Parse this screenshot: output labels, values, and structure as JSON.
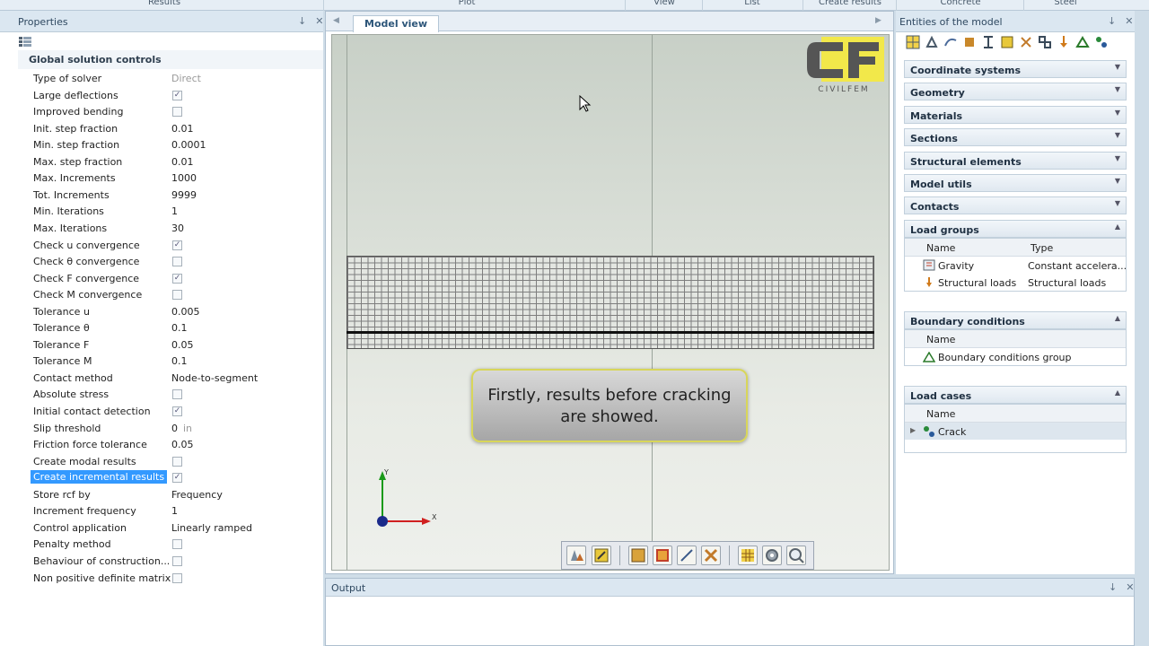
{
  "ribbon": {
    "tabs": [
      "Results",
      "Plot",
      "View",
      "List",
      "Create results",
      "Concrete",
      "Steel"
    ]
  },
  "properties": {
    "title": "Properties",
    "section": "Global solution controls",
    "rows": [
      {
        "label": "Type of solver",
        "value": "Direct",
        "kind": "gray"
      },
      {
        "label": "Large deflections",
        "checked": true,
        "kind": "check"
      },
      {
        "label": "Improved bending",
        "checked": false,
        "kind": "check"
      },
      {
        "label": "Init. step fraction",
        "value": "0.01",
        "kind": "text"
      },
      {
        "label": "Min. step fraction",
        "value": "0.0001",
        "kind": "text"
      },
      {
        "label": "Max. step fraction",
        "value": "0.01",
        "kind": "text"
      },
      {
        "label": "Max. Increments",
        "value": "1000",
        "kind": "text"
      },
      {
        "label": "Tot. Increments",
        "value": "9999",
        "kind": "text"
      },
      {
        "label": "Min. Iterations",
        "value": "1",
        "kind": "text"
      },
      {
        "label": "Max. Iterations",
        "value": "30",
        "kind": "text"
      },
      {
        "label": "Check u convergence",
        "checked": true,
        "kind": "check"
      },
      {
        "label": "Check θ convergence",
        "checked": false,
        "kind": "check"
      },
      {
        "label": "Check F convergence",
        "checked": true,
        "kind": "check"
      },
      {
        "label": "Check M convergence",
        "checked": false,
        "kind": "check"
      },
      {
        "label": "Tolerance u",
        "value": "0.005",
        "kind": "text"
      },
      {
        "label": "Tolerance θ",
        "value": "0.1",
        "kind": "text"
      },
      {
        "label": "Tolerance F",
        "value": "0.05",
        "kind": "text"
      },
      {
        "label": "Tolerance M",
        "value": "0.1",
        "kind": "text"
      },
      {
        "label": "Contact method",
        "value": "Node-to-segment",
        "kind": "text"
      },
      {
        "label": "Absolute stress",
        "checked": false,
        "kind": "check"
      },
      {
        "label": "Initial contact detection",
        "checked": true,
        "kind": "check"
      },
      {
        "label": "Slip threshold",
        "value": "0",
        "unit": "in",
        "kind": "unit"
      },
      {
        "label": "Friction force tolerance",
        "value": "0.05",
        "kind": "text"
      },
      {
        "label": "Create modal results",
        "checked": false,
        "kind": "check"
      },
      {
        "label": "Create incremental results",
        "checked": true,
        "kind": "check",
        "selected": true
      },
      {
        "label": "Store rcf by",
        "value": "Frequency",
        "kind": "text"
      },
      {
        "label": "Increment frequency",
        "value": "1",
        "kind": "text"
      },
      {
        "label": "Control application",
        "value": "Linearly ramped",
        "kind": "text"
      },
      {
        "label": "Penalty method",
        "checked": false,
        "kind": "check"
      },
      {
        "label": "Behaviour of construction...",
        "checked": false,
        "kind": "check"
      },
      {
        "label": "Non positive definite matrix",
        "checked": false,
        "kind": "check"
      }
    ]
  },
  "model_view": {
    "tab_label": "Model view",
    "callout": "Firstly, results before cracking are showed.",
    "logo_text": "CIVILFEM",
    "axis_x": "X",
    "axis_y": "Y"
  },
  "entities": {
    "title": "Entities of the model",
    "groups": [
      "Coordinate systems",
      "Geometry",
      "Materials",
      "Sections",
      "Structural elements",
      "Model utils",
      "Contacts"
    ],
    "load_groups": {
      "label": "Load groups",
      "col_name": "Name",
      "col_type": "Type",
      "rows": [
        {
          "name": "Gravity",
          "type": "Constant accelera..."
        },
        {
          "name": "Structural loads",
          "type": "Structural loads"
        }
      ]
    },
    "boundary_conditions": {
      "label": "Boundary conditions",
      "col_name": "Name",
      "rows": [
        {
          "name": "Boundary conditions group"
        }
      ]
    },
    "load_cases": {
      "label": "Load cases",
      "col_name": "Name",
      "rows": [
        {
          "name": "Crack"
        }
      ]
    }
  },
  "output": {
    "title": "Output"
  },
  "colors": {
    "selection": "#3399ff",
    "panel_header": "#dbe7f1",
    "accent_yellow": "#f2e84a"
  }
}
